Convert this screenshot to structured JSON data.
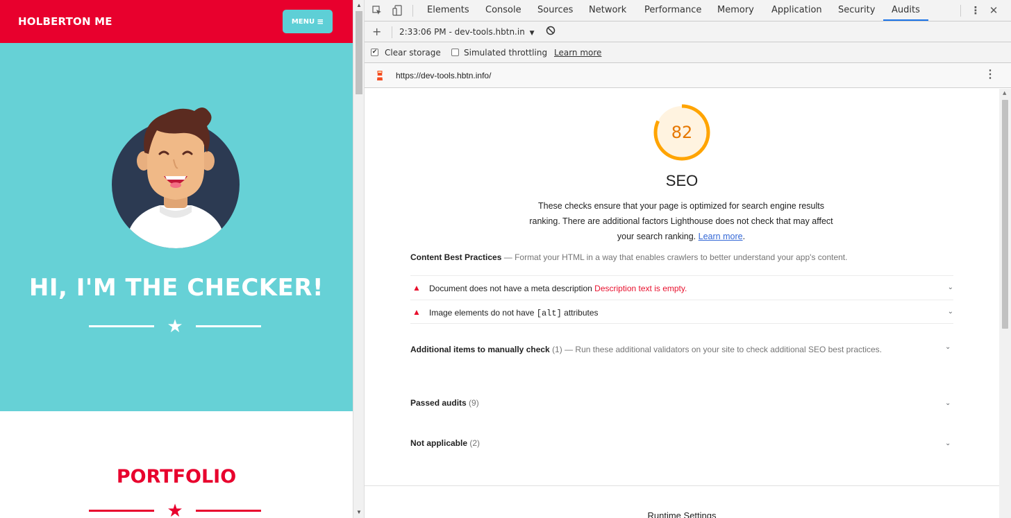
{
  "page": {
    "brand": "HOLBERTON ME",
    "menu_label": "MENU",
    "hero_title": "HI, I'M THE CHECKER!",
    "portfolio_title": "PORTFOLIO",
    "colors": {
      "brand_red": "#e8002d",
      "hero_teal": "#66d1d6",
      "menu_teal": "#5ecfd6"
    }
  },
  "devtools": {
    "tabs": [
      {
        "label": "Elements"
      },
      {
        "label": "Console"
      },
      {
        "label": "Sources"
      },
      {
        "label": "Network"
      },
      {
        "label": "Performance"
      },
      {
        "label": "Memory"
      },
      {
        "label": "Application"
      },
      {
        "label": "Security"
      },
      {
        "label": "Audits"
      }
    ],
    "active_tab": "Audits",
    "toolbar": {
      "report_select": "2:33:06 PM - dev-tools.hbtn.in"
    },
    "options": {
      "clear_storage": {
        "label": "Clear storage",
        "checked": true
      },
      "simulated_throttling": {
        "label": "Simulated throttling",
        "checked": false
      },
      "learn_more": "Learn more"
    },
    "url": "https://dev-tools.hbtn.info/",
    "report": {
      "score": "82",
      "score_fraction": 0.82,
      "score_color": "#ffa400",
      "category": "SEO",
      "description": "These checks ensure that your page is optimized for search engine results ranking. There are additional factors Lighthouse does not check that may affect your search ranking.",
      "description_link": "Learn more",
      "group": {
        "title": "Content Best Practices",
        "description": "Format your HTML in a way that enables crawlers to better understand your app's content."
      },
      "audits": [
        {
          "title": "Document does not have a meta description",
          "error": "Description text is empty."
        },
        {
          "title_pre": "Image elements do not have",
          "title_code": "[alt]",
          "title_post": "attributes"
        }
      ],
      "manual": {
        "title": "Additional items to manually check",
        "count": "(1)",
        "description": "Run these additional validators on your site to check additional SEO best practices."
      },
      "passed": {
        "title": "Passed audits",
        "count": "(9)"
      },
      "not_applicable": {
        "title": "Not applicable",
        "count": "(2)"
      },
      "runtime_settings": "Runtime Settings"
    }
  }
}
